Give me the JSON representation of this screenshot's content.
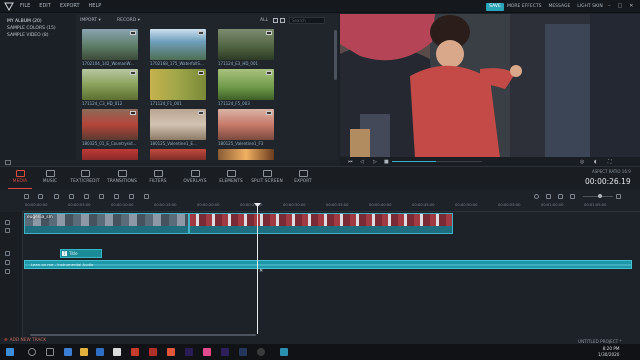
{
  "menu": {
    "items": [
      "FILE",
      "EDIT",
      "EXPORT",
      "HELP"
    ],
    "save_label": "SAVE",
    "links": [
      "MORE EFFECTS",
      "MESSAGE",
      "LIGHT SKIN"
    ]
  },
  "library": {
    "albums": [
      "MY ALBUM (20)",
      "SAMPLE COLORS (15)",
      "SAMPLE VIDEO (8)"
    ],
    "import_label": "IMPORT",
    "record_label": "RECORD",
    "filter_label": "ALL",
    "search_placeholder": "Search",
    "captions": [
      "1702104_142_WomanW...",
      "1702168_175_WaterfallS...",
      "171124_E3_HD_001",
      "171124_C3_HD_012",
      "171124_F1_001",
      "171124_F5_003",
      "180325_01_E_Countrysid...",
      "180125_Valentine1_E...",
      "180125_Valentine1_F3",
      "",
      "",
      ""
    ]
  },
  "ribbon": {
    "tabs": [
      "MEDIA",
      "MUSIC",
      "TEXT/CREDIT",
      "TRANSITIONS",
      "FILTERS",
      "OVERLAYS",
      "ELEMENTS",
      "SPLIT SCREEN",
      "EXPORT"
    ],
    "aspect_label": "ASPECT RATIO 16:9",
    "timecode": "00:00:26.19"
  },
  "timeline": {
    "ruler": [
      "00:00:00:00",
      "00:00:05:00",
      "00:00:10:00",
      "00:00:15:00",
      "00:00:20:00",
      "00:00:25:00",
      "00:00:30:00",
      "00:00:35:00",
      "00:00:40:00",
      "00:00:45:00",
      "00:00:50:00",
      "00:00:55:00",
      "00:01:00:00",
      "00:01:05:00"
    ],
    "clip1_label": "eugenia_sm",
    "clip2_label": "",
    "text_clip_label": "Title",
    "audio_label": "Lean on me - Instrumental Audio",
    "add_track_label": "ADD NEW TRACK",
    "project_name": "UNTITLED PROJECT *"
  },
  "taskbar": {
    "time": "8:20 PM",
    "date": "1/30/2020"
  },
  "colors": {
    "accent": "#2aa5b8",
    "active_tab": "#e0493b"
  }
}
